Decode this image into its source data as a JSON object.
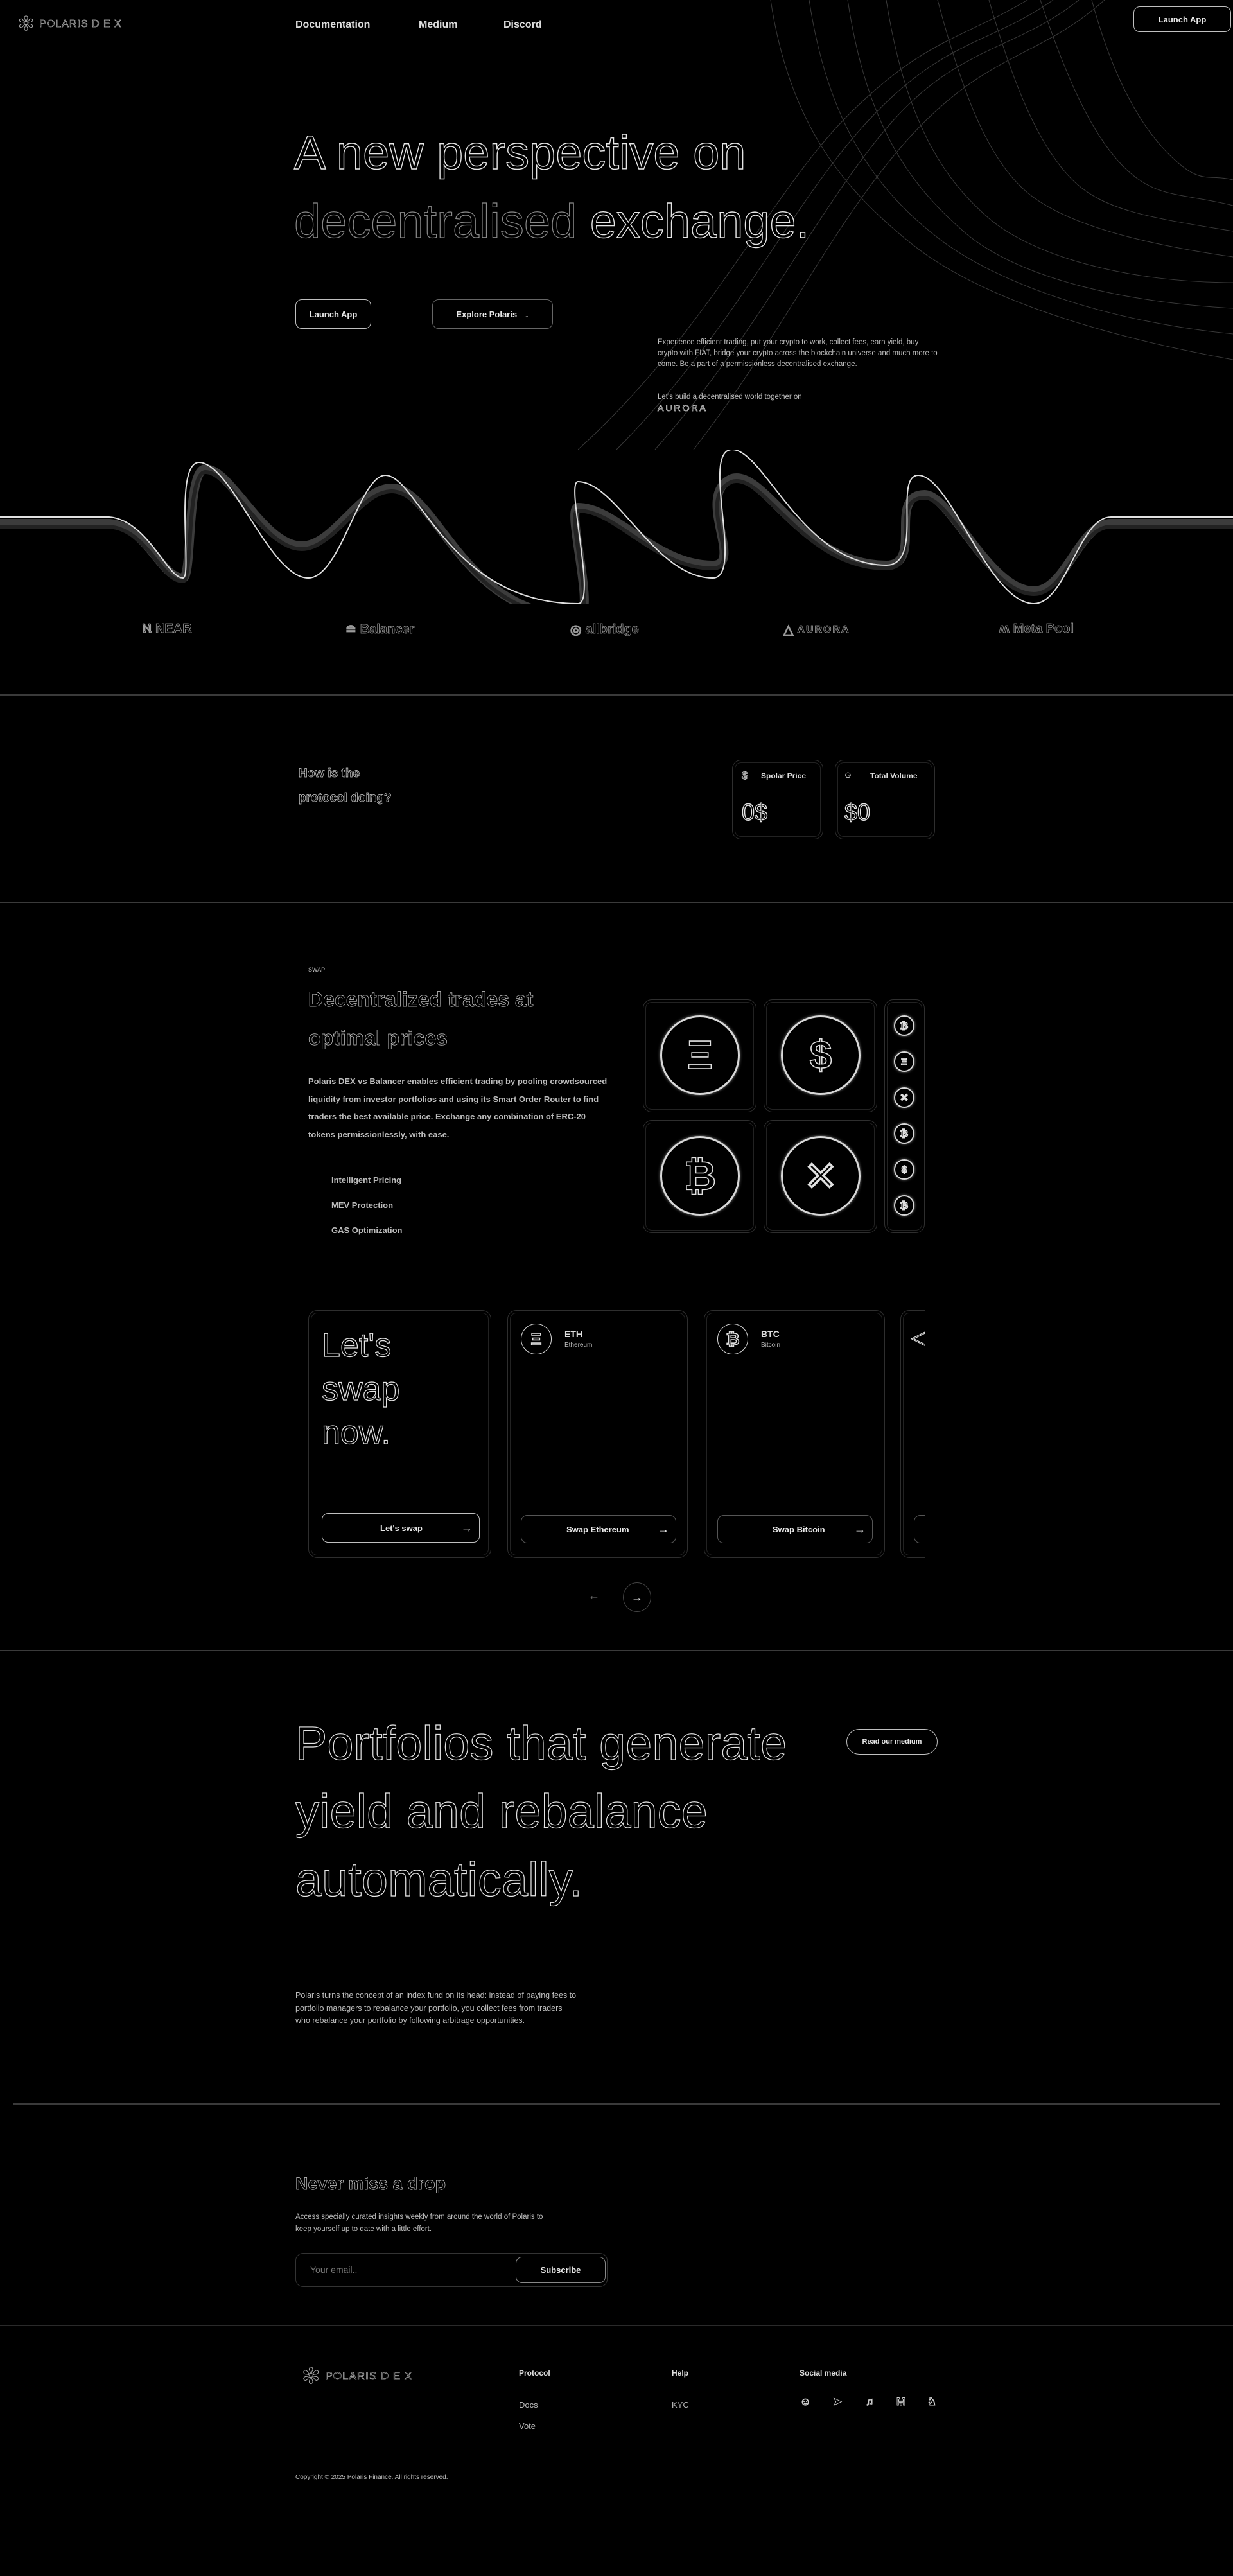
{
  "nav": {
    "brand": "POLARIS D E X",
    "links": [
      "Documentation",
      "Medium",
      "Discord"
    ],
    "launch_label": "Launch App"
  },
  "hero": {
    "title_line1": "A new perspective on",
    "title_word_dim": "decentralised",
    "title_word_bright": "exchange.",
    "launch_label": "Launch App",
    "explore_label": "Explore Polaris",
    "description": "Experience efficient trading, put your crypto to work, collect fees, earn yield, buy crypto with FIAT, bridge your crypto across the blockchain universe and much more to come. Be a part of a permissionless decentralised exchange.",
    "build_text": "Let's build a decentralised world together on",
    "build_logo": "AURORA"
  },
  "partners": [
    "NEAR",
    "Balancer",
    "allbridge",
    "AURORA",
    "Meta Pool"
  ],
  "stats": {
    "question": "How is the protocol doing?",
    "cards": [
      {
        "label": "Spolar Price",
        "value": "0$",
        "icon": "dollar-icon"
      },
      {
        "label": "Total Volume",
        "value": "$0",
        "icon": "volume-icon"
      }
    ]
  },
  "swap": {
    "eyebrow": "SWAP",
    "heading": "Decentralized trades at optimal prices",
    "body": "Polaris DEX vs Balancer enables efficient trading by pooling crowdsourced liquidity from investor portfolios and using its Smart Order Router to find traders the best available price. Exchange any combination of ERC-20 tokens permissionlessly, with ease.",
    "features": [
      "Intelligent Pricing",
      "MEV Protection",
      "GAS Optimization"
    ],
    "tokens_large": [
      {
        "icon": "ethereum-coin-icon",
        "glyph": "Ξ"
      },
      {
        "icon": "usd-coin-icon",
        "glyph": "$"
      },
      {
        "icon": "bitcoin-coin-icon",
        "glyph": "₿"
      },
      {
        "icon": "near-coin-icon",
        "glyph": "✕"
      }
    ],
    "tokens_small": [
      "₿",
      "Ξ",
      "✕",
      "₿",
      "$",
      "₿"
    ]
  },
  "carousel": {
    "intro_title": "Let's swap now.",
    "intro_button": "Let's swap",
    "cards": [
      {
        "symbol": "ETH",
        "name": "Ethereum",
        "glyph": "Ξ",
        "button": "Swap Ethereum"
      },
      {
        "symbol": "BTC",
        "name": "Bitcoin",
        "glyph": "₿",
        "button": "Swap Bitcoin"
      }
    ],
    "prev_arrow": "←",
    "next_arrow": "→"
  },
  "portfolios": {
    "heading_line1": "Portfolios that generate",
    "heading_line2": "yield and rebalance",
    "heading_line3": "automatically.",
    "medium_button": "Read our medium",
    "body": "Polaris turns the concept of an index fund on its head: instead of paying fees to portfolio managers to rebalance your portfolio, you collect fees from traders who rebalance your portfolio by following arbitrage opportunities."
  },
  "newsletter": {
    "heading": "Never miss a drop",
    "body": "Access specially curated insights weekly from around the world of Polaris to keep yourself up to date with a little effort.",
    "email_placeholder": "Your email..",
    "subscribe_label": "Subscribe"
  },
  "footer": {
    "brand": "POLARIS D E X",
    "protocol_heading": "Protocol",
    "protocol_links": [
      "Docs",
      "Vote"
    ],
    "help_heading": "Help",
    "help_links": [
      "KYC"
    ],
    "social_heading": "Social media",
    "social_icons": [
      "discord-icon",
      "telegram-icon",
      "twitter-icon",
      "medium-icon",
      "github-icon"
    ],
    "copyright": "Copyright © 2025 Polaris Finance. All rights reserved."
  }
}
